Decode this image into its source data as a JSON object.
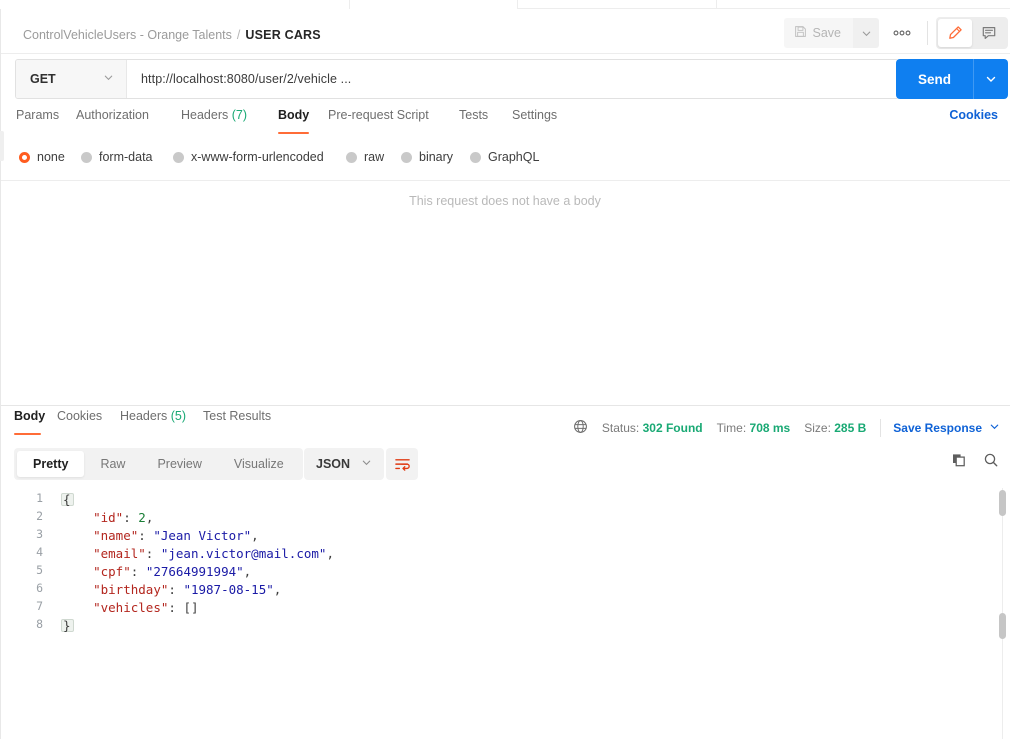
{
  "window": {
    "breadcrumb": {
      "collection": "ControlVehicleUsers - Orange Talents",
      "separator": "/",
      "request_name": "USER CARS"
    },
    "save_label": "Save",
    "more_label": "000",
    "icons": {
      "save": "floppy-disk-icon",
      "save_caret": "chevron-down-icon",
      "more": "more-horizontal-icon",
      "edit": "pencil-icon",
      "comment": "comment-icon"
    }
  },
  "request": {
    "method": "GET",
    "method_caret": "⌄",
    "url": "http://localhost:8080/user/2/vehicle ...",
    "send_label": "Send",
    "send_caret": "⌄",
    "tabs": [
      {
        "label": "Params",
        "count": "",
        "selected": false
      },
      {
        "label": "Authorization",
        "count": "",
        "selected": false
      },
      {
        "label": "Headers",
        "count": "(7)",
        "selected": false
      },
      {
        "label": "Body",
        "count": "",
        "selected": true
      },
      {
        "label": "Pre-request Script",
        "count": "",
        "selected": false
      },
      {
        "label": "Tests",
        "count": "",
        "selected": false
      },
      {
        "label": "Settings",
        "count": "",
        "selected": false
      }
    ],
    "cookies_link": "Cookies",
    "body_types": [
      {
        "label": "none",
        "selected": true
      },
      {
        "label": "form-data",
        "selected": false
      },
      {
        "label": "x-www-form-urlencoded",
        "selected": false
      },
      {
        "label": "raw",
        "selected": false
      },
      {
        "label": "binary",
        "selected": false
      },
      {
        "label": "GraphQL",
        "selected": false
      }
    ],
    "empty_body_message": "This request does not have a body"
  },
  "response": {
    "tabs": [
      {
        "label": "Body",
        "count": "",
        "selected": true
      },
      {
        "label": "Cookies",
        "count": "",
        "selected": false
      },
      {
        "label": "Headers",
        "count": "(5)",
        "selected": false
      },
      {
        "label": "Test Results",
        "count": "",
        "selected": false
      }
    ],
    "meta": {
      "globe_icon": "globe-icon",
      "status_label": "Status:",
      "status_value": "302 Found",
      "time_label": "Time:",
      "time_value": "708 ms",
      "size_label": "Size:",
      "size_value": "285 B",
      "save_response_label": "Save Response",
      "save_response_caret": "⌄"
    },
    "view_modes": [
      {
        "label": "Pretty",
        "selected": true
      },
      {
        "label": "Raw",
        "selected": false
      },
      {
        "label": "Preview",
        "selected": false
      },
      {
        "label": "Visualize",
        "selected": false
      }
    ],
    "format": "JSON",
    "format_caret": "⌄",
    "wrap_icon": "word-wrap-icon",
    "copy_icon": "copy-icon",
    "search_icon": "search-icon",
    "body_lines": [
      {
        "num": "1",
        "segments": [
          {
            "t": "{",
            "c": "p"
          }
        ]
      },
      {
        "num": "2",
        "segments": [
          {
            "t": "    ",
            "c": "p"
          },
          {
            "t": "\"id\"",
            "c": "k"
          },
          {
            "t": ": ",
            "c": "p"
          },
          {
            "t": "2",
            "c": "n"
          },
          {
            "t": ",",
            "c": "p"
          }
        ]
      },
      {
        "num": "3",
        "segments": [
          {
            "t": "    ",
            "c": "p"
          },
          {
            "t": "\"name\"",
            "c": "k"
          },
          {
            "t": ": ",
            "c": "p"
          },
          {
            "t": "\"Jean Victor\"",
            "c": "s"
          },
          {
            "t": ",",
            "c": "p"
          }
        ]
      },
      {
        "num": "4",
        "segments": [
          {
            "t": "    ",
            "c": "p"
          },
          {
            "t": "\"email\"",
            "c": "k"
          },
          {
            "t": ": ",
            "c": "p"
          },
          {
            "t": "\"jean.victor@mail.com\"",
            "c": "s"
          },
          {
            "t": ",",
            "c": "p"
          }
        ]
      },
      {
        "num": "5",
        "segments": [
          {
            "t": "    ",
            "c": "p"
          },
          {
            "t": "\"cpf\"",
            "c": "k"
          },
          {
            "t": ": ",
            "c": "p"
          },
          {
            "t": "\"27664991994\"",
            "c": "s"
          },
          {
            "t": ",",
            "c": "p"
          }
        ]
      },
      {
        "num": "6",
        "segments": [
          {
            "t": "    ",
            "c": "p"
          },
          {
            "t": "\"birthday\"",
            "c": "k"
          },
          {
            "t": ": ",
            "c": "p"
          },
          {
            "t": "\"1987-08-15\"",
            "c": "s"
          },
          {
            "t": ",",
            "c": "p"
          }
        ]
      },
      {
        "num": "7",
        "segments": [
          {
            "t": "    ",
            "c": "p"
          },
          {
            "t": "\"vehicles\"",
            "c": "k"
          },
          {
            "t": ": ",
            "c": "p"
          },
          {
            "t": "[]",
            "c": "p"
          }
        ]
      },
      {
        "num": "8",
        "segments": [
          {
            "t": "}",
            "c": "p"
          }
        ]
      }
    ]
  },
  "colors": {
    "accent_orange": "#ff6c37",
    "send_blue": "#0f7ff0",
    "link_blue": "#0f62d6",
    "status_green": "#19a974",
    "key_red": "#b3261e",
    "string_blue": "#1a1aa6",
    "number_green": "#1a7f37"
  }
}
